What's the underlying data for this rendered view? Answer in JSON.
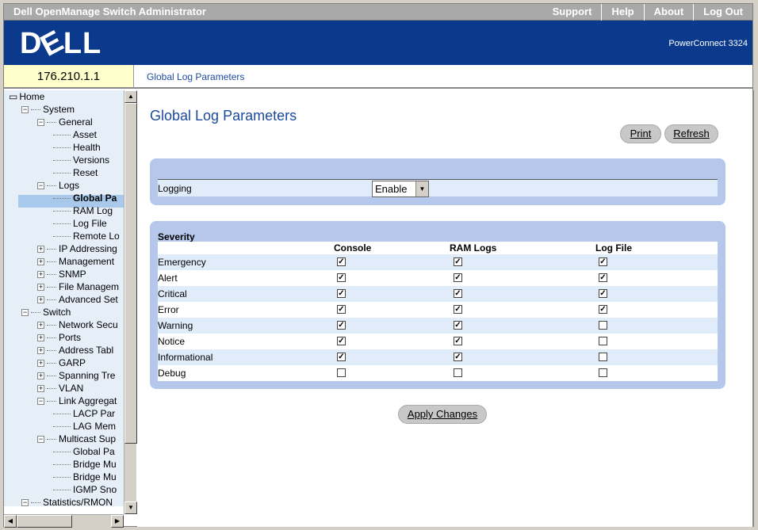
{
  "header": {
    "title": "Dell OpenManage Switch Administrator",
    "links": [
      "Support",
      "Help",
      "About",
      "Log Out"
    ]
  },
  "brand": {
    "logo": "DELL",
    "model": "PowerConnect 3324"
  },
  "ip": "176.210.1.1",
  "breadcrumb": "Global Log Parameters",
  "tree": {
    "items": [
      {
        "label": "Home",
        "level": 0,
        "type": "home"
      },
      {
        "label": "System",
        "level": 1,
        "type": "minus"
      },
      {
        "label": "General",
        "level": 2,
        "type": "minus"
      },
      {
        "label": "Asset",
        "level": 3,
        "type": "leaf"
      },
      {
        "label": "Health",
        "level": 3,
        "type": "leaf"
      },
      {
        "label": "Versions",
        "level": 3,
        "type": "leaf"
      },
      {
        "label": "Reset",
        "level": 3,
        "type": "leaf"
      },
      {
        "label": "Logs",
        "level": 2,
        "type": "minus"
      },
      {
        "label": "Global Pa",
        "level": 3,
        "type": "leaf",
        "selected": true
      },
      {
        "label": "RAM Log",
        "level": 3,
        "type": "leaf"
      },
      {
        "label": "Log File",
        "level": 3,
        "type": "leaf"
      },
      {
        "label": "Remote Lo",
        "level": 3,
        "type": "leaf"
      },
      {
        "label": "IP Addressing",
        "level": 2,
        "type": "plus"
      },
      {
        "label": "Management",
        "level": 2,
        "type": "plus"
      },
      {
        "label": "SNMP",
        "level": 2,
        "type": "plus"
      },
      {
        "label": "File Managem",
        "level": 2,
        "type": "plus"
      },
      {
        "label": "Advanced Set",
        "level": 2,
        "type": "plus"
      },
      {
        "label": "Switch",
        "level": 1,
        "type": "minus"
      },
      {
        "label": "Network Secu",
        "level": 2,
        "type": "plus"
      },
      {
        "label": "Ports",
        "level": 2,
        "type": "plus"
      },
      {
        "label": "Address Tabl",
        "level": 2,
        "type": "plus"
      },
      {
        "label": "GARP",
        "level": 2,
        "type": "plus"
      },
      {
        "label": "Spanning Tre",
        "level": 2,
        "type": "plus"
      },
      {
        "label": "VLAN",
        "level": 2,
        "type": "plus"
      },
      {
        "label": "Link Aggregat",
        "level": 2,
        "type": "minus"
      },
      {
        "label": "LACP Par",
        "level": 3,
        "type": "leaf"
      },
      {
        "label": "LAG Mem",
        "level": 3,
        "type": "leaf"
      },
      {
        "label": "Multicast Sup",
        "level": 2,
        "type": "minus"
      },
      {
        "label": "Global Pa",
        "level": 3,
        "type": "leaf"
      },
      {
        "label": "Bridge Mu",
        "level": 3,
        "type": "leaf"
      },
      {
        "label": "Bridge Mu",
        "level": 3,
        "type": "leaf"
      },
      {
        "label": "IGMP Sno",
        "level": 3,
        "type": "leaf"
      },
      {
        "label": "Statistics/RMON",
        "level": 1,
        "type": "minus"
      }
    ]
  },
  "main": {
    "title": "Global Log Parameters",
    "print_label": "Print",
    "refresh_label": "Refresh",
    "logging_label": "Logging",
    "logging_value": "Enable",
    "severity_label": "Severity",
    "columns": [
      "Console",
      "RAM Logs",
      "Log File"
    ],
    "severities": [
      {
        "name": "Emergency",
        "console": true,
        "ram": true,
        "file": true
      },
      {
        "name": "Alert",
        "console": true,
        "ram": true,
        "file": true
      },
      {
        "name": "Critical",
        "console": true,
        "ram": true,
        "file": true
      },
      {
        "name": "Error",
        "console": true,
        "ram": true,
        "file": true
      },
      {
        "name": "Warning",
        "console": true,
        "ram": true,
        "file": false
      },
      {
        "name": "Notice",
        "console": true,
        "ram": true,
        "file": false
      },
      {
        "name": "Informational",
        "console": true,
        "ram": true,
        "file": false
      },
      {
        "name": "Debug",
        "console": false,
        "ram": false,
        "file": false
      }
    ],
    "apply_label": "Apply Changes"
  },
  "colors": {
    "brand_blue": "#0b3a8d",
    "title_blue": "#1c4a9c",
    "panel_blue": "#b5c7ea",
    "row_light": "#e1ecfa",
    "ip_yellow": "#ffffcc"
  }
}
